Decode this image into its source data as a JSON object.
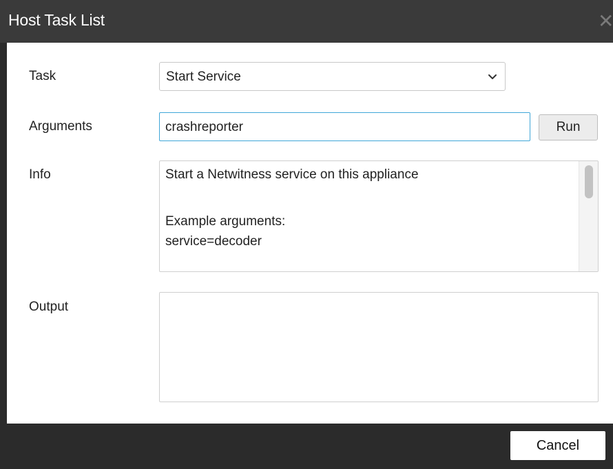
{
  "dialog": {
    "title": "Host Task List",
    "close_icon": "close-icon"
  },
  "form": {
    "task_label": "Task",
    "task_selected": "Start Service",
    "arguments_label": "Arguments",
    "arguments_value": "crashreporter",
    "run_label": "Run",
    "info_label": "Info",
    "info_lines": [
      "Start a Netwitness service on this appliance",
      "",
      "Example arguments:",
      "service=decoder"
    ],
    "output_label": "Output",
    "output_value": ""
  },
  "footer": {
    "cancel_label": "Cancel"
  },
  "colors": {
    "titlebar": "#3a3a3a",
    "footer": "#2b2b2b",
    "input_focus_border": "#3fa6d8"
  }
}
